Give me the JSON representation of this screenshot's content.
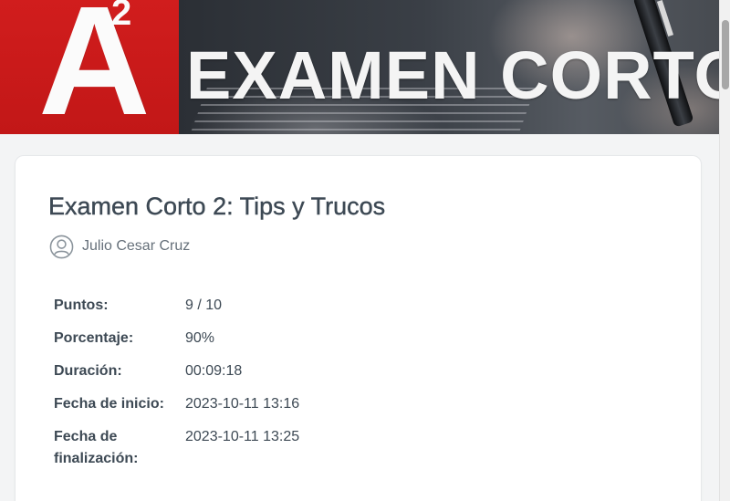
{
  "banner": {
    "logo_letter": "A",
    "logo_superscript": "2",
    "title": "EXAMEN CORTO"
  },
  "exam": {
    "title": "Examen Corto 2: Tips y Trucos",
    "author": "Julio Cesar Cruz",
    "author_icon": "user-avatar-icon"
  },
  "results": [
    {
      "label": "Puntos:",
      "value": "9 / 10"
    },
    {
      "label": "Porcentaje:",
      "value": "90%"
    },
    {
      "label": "Duración:",
      "value": "00:09:18"
    },
    {
      "label": "Fecha de inicio:",
      "value": "2023-10-11 13:16"
    },
    {
      "label": "Fecha de finalización:",
      "value": "2023-10-11 13:25"
    }
  ],
  "colors": {
    "brand_red": "#c91a1a",
    "text": "#3d4954",
    "muted": "#66707a"
  }
}
